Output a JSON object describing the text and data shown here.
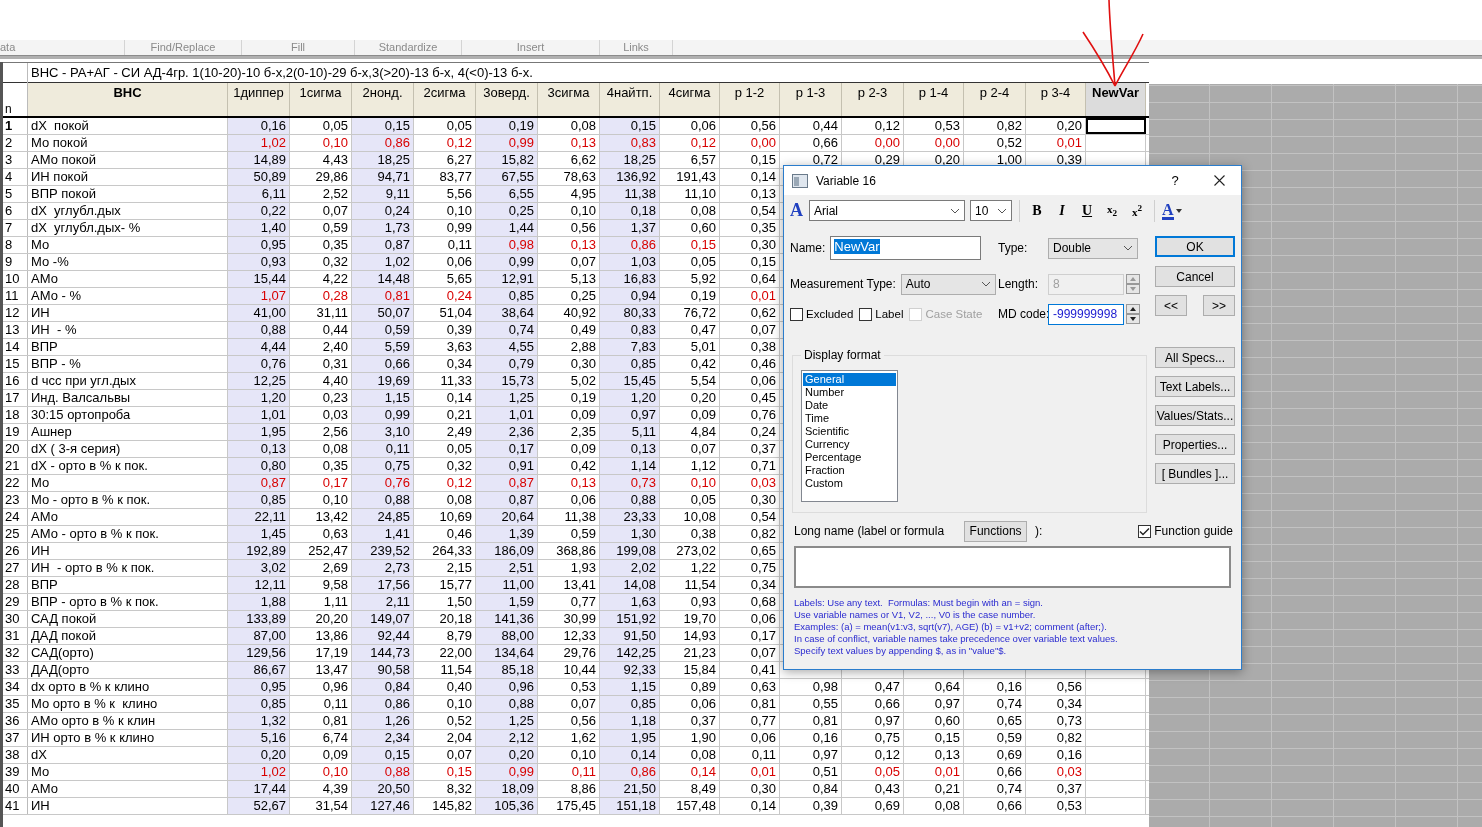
{
  "ribbon_groups": [
    "ata",
    "Find/Replace",
    "Fill",
    "Standardize",
    "Insert",
    "Links"
  ],
  "sheet": {
    "title": "ВНС - РА+АГ - СИ АД-4гр. 1(10-20)-10 б-х,2(0-10)-29 б-х,3(>20)-13 б-х, 4(<0)-13 б-х.",
    "row_header_label": "n",
    "label_column": {
      "label": "ВНС"
    },
    "columns": [
      {
        "label": "1диппер",
        "shaded": true,
        "selected": false
      },
      {
        "label": "1сигма",
        "shaded": false,
        "selected": false
      },
      {
        "label": "2нонд.",
        "shaded": true,
        "selected": false
      },
      {
        "label": "2сигма",
        "shaded": false,
        "selected": false
      },
      {
        "label": "3оверд.",
        "shaded": true,
        "selected": false
      },
      {
        "label": "3сигма",
        "shaded": false,
        "selected": false
      },
      {
        "label": "4найтп.",
        "shaded": true,
        "selected": false
      },
      {
        "label": "4сигма",
        "shaded": false,
        "selected": false
      },
      {
        "label": "p 1-2",
        "shaded": false,
        "selected": false
      },
      {
        "label": "p 1-3",
        "shaded": false,
        "selected": false
      },
      {
        "label": "p 2-3",
        "shaded": false,
        "selected": false
      },
      {
        "label": "p 1-4",
        "shaded": false,
        "selected": false
      },
      {
        "label": "p 2-4",
        "shaded": false,
        "selected": false
      },
      {
        "label": "p 3-4",
        "shaded": false,
        "selected": false
      },
      {
        "label": "NewVar",
        "shaded": false,
        "selected": true
      }
    ],
    "rows": [
      {
        "n": "1",
        "name": "dX  покой",
        "selected": true,
        "cells": [
          "0,16",
          "0,05",
          "0,15",
          "0,05",
          "0,19",
          "0,08",
          "0,15",
          "0,06",
          "0,56",
          "0,44",
          "0,12",
          "0,53",
          "0,82",
          "0,20"
        ],
        "red": [
          false,
          false,
          false,
          false,
          false,
          false,
          false,
          false,
          false,
          false,
          false,
          false,
          false,
          false
        ]
      },
      {
        "n": "2",
        "name": "Мо покой",
        "selected": false,
        "cells": [
          "1,02",
          "0,10",
          "0,86",
          "0,12",
          "0,99",
          "0,13",
          "0,83",
          "0,12",
          "0,00",
          "0,66",
          "0,00",
          "0,00",
          "0,52",
          "0,01"
        ],
        "red": [
          true,
          true,
          true,
          true,
          true,
          true,
          true,
          true,
          true,
          false,
          true,
          true,
          false,
          true
        ]
      },
      {
        "n": "3",
        "name": "АМо покой",
        "selected": false,
        "cells": [
          "14,89",
          "4,43",
          "18,25",
          "6,27",
          "15,82",
          "6,62",
          "18,25",
          "6,57",
          "0,15",
          "0,72",
          "0,29",
          "0,20",
          "1,00",
          "0,39"
        ],
        "red": [
          false,
          false,
          false,
          false,
          false,
          false,
          false,
          false,
          false,
          false,
          false,
          false,
          false,
          false
        ]
      },
      {
        "n": "4",
        "name": "ИН покой",
        "selected": false,
        "cells": [
          "50,89",
          "29,86",
          "94,71",
          "83,77",
          "67,55",
          "78,63",
          "136,92",
          "191,43",
          "0,14"
        ],
        "red": [
          false,
          false,
          false,
          false,
          false,
          false,
          false,
          false,
          false
        ]
      },
      {
        "n": "5",
        "name": "ВПР покой",
        "selected": false,
        "cells": [
          "6,11",
          "2,52",
          "9,11",
          "5,56",
          "6,55",
          "4,95",
          "11,38",
          "11,10",
          "0,13"
        ],
        "red": [
          false,
          false,
          false,
          false,
          false,
          false,
          false,
          false,
          false
        ]
      },
      {
        "n": "6",
        "name": "dX  углубл.дых",
        "selected": false,
        "cells": [
          "0,22",
          "0,07",
          "0,24",
          "0,10",
          "0,25",
          "0,10",
          "0,18",
          "0,08",
          "0,54"
        ],
        "red": [
          false,
          false,
          false,
          false,
          false,
          false,
          false,
          false,
          false
        ]
      },
      {
        "n": "7",
        "name": "dX  углубл.дых- %",
        "selected": false,
        "cells": [
          "1,40",
          "0,59",
          "1,73",
          "0,99",
          "1,44",
          "0,56",
          "1,37",
          "0,60",
          "0,35"
        ],
        "red": [
          false,
          false,
          false,
          false,
          false,
          false,
          false,
          false,
          false
        ]
      },
      {
        "n": "8",
        "name": "Мо",
        "selected": false,
        "cells": [
          "0,95",
          "0,35",
          "0,87",
          "0,11",
          "0,98",
          "0,13",
          "0,86",
          "0,15",
          "0,30"
        ],
        "red": [
          false,
          false,
          false,
          false,
          true,
          true,
          true,
          true,
          false
        ]
      },
      {
        "n": "9",
        "name": "Мо -%",
        "selected": false,
        "cells": [
          "0,93",
          "0,32",
          "1,02",
          "0,06",
          "0,99",
          "0,07",
          "1,03",
          "0,05",
          "0,15"
        ],
        "red": [
          false,
          false,
          false,
          false,
          false,
          false,
          false,
          false,
          false
        ]
      },
      {
        "n": "10",
        "name": "АМо",
        "selected": false,
        "cells": [
          "15,44",
          "4,22",
          "14,48",
          "5,65",
          "12,91",
          "5,13",
          "16,83",
          "5,92",
          "0,64"
        ],
        "red": [
          false,
          false,
          false,
          false,
          false,
          false,
          false,
          false,
          false
        ]
      },
      {
        "n": "11",
        "name": "АМо - %",
        "selected": false,
        "cells": [
          "1,07",
          "0,28",
          "0,81",
          "0,24",
          "0,85",
          "0,25",
          "0,94",
          "0,19",
          "0,01"
        ],
        "red": [
          true,
          true,
          true,
          true,
          false,
          false,
          false,
          false,
          true
        ]
      },
      {
        "n": "12",
        "name": "ИН",
        "selected": false,
        "cells": [
          "41,00",
          "31,11",
          "50,07",
          "51,04",
          "38,64",
          "40,92",
          "80,33",
          "76,72",
          "0,62"
        ],
        "red": [
          false,
          false,
          false,
          false,
          false,
          false,
          false,
          false,
          false
        ]
      },
      {
        "n": "13",
        "name": "ИН  - %",
        "selected": false,
        "cells": [
          "0,88",
          "0,44",
          "0,59",
          "0,39",
          "0,74",
          "0,49",
          "0,83",
          "0,47",
          "0,07"
        ],
        "red": [
          false,
          false,
          false,
          false,
          false,
          false,
          false,
          false,
          false
        ]
      },
      {
        "n": "14",
        "name": "ВПР",
        "selected": false,
        "cells": [
          "4,44",
          "2,40",
          "5,59",
          "3,63",
          "4,55",
          "2,88",
          "7,83",
          "5,01",
          "0,38"
        ],
        "red": [
          false,
          false,
          false,
          false,
          false,
          false,
          false,
          false,
          false
        ]
      },
      {
        "n": "15",
        "name": "ВПР - %",
        "selected": false,
        "cells": [
          "0,76",
          "0,31",
          "0,66",
          "0,34",
          "0,79",
          "0,30",
          "0,85",
          "0,42",
          "0,46"
        ],
        "red": [
          false,
          false,
          false,
          false,
          false,
          false,
          false,
          false,
          false
        ]
      },
      {
        "n": "16",
        "name": "d чсс при угл.дых",
        "selected": false,
        "cells": [
          "12,25",
          "4,40",
          "19,69",
          "11,33",
          "15,73",
          "5,02",
          "15,45",
          "5,54",
          "0,06"
        ],
        "red": [
          false,
          false,
          false,
          false,
          false,
          false,
          false,
          false,
          false
        ]
      },
      {
        "n": "17",
        "name": "Инд. Валсальвы",
        "selected": false,
        "cells": [
          "1,20",
          "0,23",
          "1,15",
          "0,14",
          "1,25",
          "0,19",
          "1,20",
          "0,20",
          "0,45"
        ],
        "red": [
          false,
          false,
          false,
          false,
          false,
          false,
          false,
          false,
          false
        ]
      },
      {
        "n": "18",
        "name": "30:15 ортопроба",
        "selected": false,
        "cells": [
          "1,01",
          "0,03",
          "0,99",
          "0,21",
          "1,01",
          "0,09",
          "0,97",
          "0,09",
          "0,76"
        ],
        "red": [
          false,
          false,
          false,
          false,
          false,
          false,
          false,
          false,
          false
        ]
      },
      {
        "n": "19",
        "name": "Ашнер",
        "selected": false,
        "cells": [
          "1,95",
          "2,56",
          "3,10",
          "2,49",
          "2,36",
          "2,35",
          "5,11",
          "4,84",
          "0,24"
        ],
        "red": [
          false,
          false,
          false,
          false,
          false,
          false,
          false,
          false,
          false
        ]
      },
      {
        "n": "20",
        "name": "dX ( 3-я серия)",
        "selected": false,
        "cells": [
          "0,13",
          "0,08",
          "0,11",
          "0,05",
          "0,17",
          "0,09",
          "0,13",
          "0,07",
          "0,37"
        ],
        "red": [
          false,
          false,
          false,
          false,
          false,
          false,
          false,
          false,
          false
        ]
      },
      {
        "n": "21",
        "name": "dX - орто в % к пок.",
        "selected": false,
        "cells": [
          "0,80",
          "0,35",
          "0,75",
          "0,32",
          "0,91",
          "0,42",
          "1,14",
          "1,12",
          "0,71"
        ],
        "red": [
          false,
          false,
          false,
          false,
          false,
          false,
          false,
          false,
          false
        ]
      },
      {
        "n": "22",
        "name": "Мо",
        "selected": false,
        "cells": [
          "0,87",
          "0,17",
          "0,76",
          "0,12",
          "0,87",
          "0,13",
          "0,73",
          "0,10",
          "0,03"
        ],
        "red": [
          true,
          true,
          true,
          true,
          true,
          true,
          true,
          true,
          true
        ]
      },
      {
        "n": "23",
        "name": "Мо - орто в % к пок.",
        "selected": false,
        "cells": [
          "0,85",
          "0,10",
          "0,88",
          "0,08",
          "0,87",
          "0,06",
          "0,88",
          "0,05",
          "0,30"
        ],
        "red": [
          false,
          false,
          false,
          false,
          false,
          false,
          false,
          false,
          false
        ]
      },
      {
        "n": "24",
        "name": "АМо",
        "selected": false,
        "cells": [
          "22,11",
          "13,42",
          "24,85",
          "10,69",
          "20,64",
          "11,38",
          "23,33",
          "10,08",
          "0,54"
        ],
        "red": [
          false,
          false,
          false,
          false,
          false,
          false,
          false,
          false,
          false
        ]
      },
      {
        "n": "25",
        "name": "АМо - орто в % к пок.",
        "selected": false,
        "cells": [
          "1,45",
          "0,63",
          "1,41",
          "0,46",
          "1,39",
          "0,59",
          "1,30",
          "0,38",
          "0,82"
        ],
        "red": [
          false,
          false,
          false,
          false,
          false,
          false,
          false,
          false,
          false
        ]
      },
      {
        "n": "26",
        "name": "ИН",
        "selected": false,
        "cells": [
          "192,89",
          "252,47",
          "239,52",
          "264,33",
          "186,09",
          "368,86",
          "199,08",
          "273,02",
          "0,65"
        ],
        "red": [
          false,
          false,
          false,
          false,
          false,
          false,
          false,
          false,
          false
        ]
      },
      {
        "n": "27",
        "name": "ИН  - орто в % к пок.",
        "selected": false,
        "cells": [
          "3,02",
          "2,69",
          "2,73",
          "2,15",
          "2,51",
          "1,93",
          "2,02",
          "1,22",
          "0,75"
        ],
        "red": [
          false,
          false,
          false,
          false,
          false,
          false,
          false,
          false,
          false
        ]
      },
      {
        "n": "28",
        "name": "ВПР",
        "selected": false,
        "cells": [
          "12,11",
          "9,58",
          "17,56",
          "15,77",
          "11,00",
          "13,41",
          "14,08",
          "11,54",
          "0,34"
        ],
        "red": [
          false,
          false,
          false,
          false,
          false,
          false,
          false,
          false,
          false
        ]
      },
      {
        "n": "29",
        "name": "ВПР - орто в % к пок.",
        "selected": false,
        "cells": [
          "1,88",
          "1,11",
          "2,11",
          "1,50",
          "1,59",
          "0,77",
          "1,63",
          "0,93",
          "0,68"
        ],
        "red": [
          false,
          false,
          false,
          false,
          false,
          false,
          false,
          false,
          false
        ]
      },
      {
        "n": "30",
        "name": "САД покой",
        "selected": false,
        "cells": [
          "133,89",
          "20,20",
          "149,07",
          "20,18",
          "141,36",
          "30,99",
          "151,92",
          "19,70",
          "0,06"
        ],
        "red": [
          false,
          false,
          false,
          false,
          false,
          false,
          false,
          false,
          false
        ]
      },
      {
        "n": "31",
        "name": "ДАД покой",
        "selected": false,
        "cells": [
          "87,00",
          "13,86",
          "92,44",
          "8,79",
          "88,00",
          "12,33",
          "91,50",
          "14,93",
          "0,17"
        ],
        "red": [
          false,
          false,
          false,
          false,
          false,
          false,
          false,
          false,
          false
        ]
      },
      {
        "n": "32",
        "name": "САД(орто)",
        "selected": false,
        "cells": [
          "129,56",
          "17,19",
          "144,73",
          "22,00",
          "134,64",
          "29,76",
          "142,25",
          "21,23",
          "0,07"
        ],
        "red": [
          false,
          false,
          false,
          false,
          false,
          false,
          false,
          false,
          false
        ]
      },
      {
        "n": "33",
        "name": "ДАД(орто",
        "selected": false,
        "cells": [
          "86,67",
          "13,47",
          "90,58",
          "11,54",
          "85,18",
          "10,44",
          "92,33",
          "15,84",
          "0,41"
        ],
        "red": [
          false,
          false,
          false,
          false,
          false,
          false,
          false,
          false,
          false
        ]
      },
      {
        "n": "34",
        "name": "dx орто в % к клино",
        "selected": false,
        "cells": [
          "0,95",
          "0,96",
          "0,84",
          "0,40",
          "0,96",
          "0,53",
          "1,15",
          "0,89",
          "0,63",
          "0,98",
          "0,47",
          "0,64",
          "0,16",
          "0,56"
        ],
        "red": [
          false,
          false,
          false,
          false,
          false,
          false,
          false,
          false,
          false,
          false,
          false,
          false,
          false,
          false
        ]
      },
      {
        "n": "35",
        "name": "Мо орто в % к  клино",
        "selected": false,
        "cells": [
          "0,85",
          "0,11",
          "0,86",
          "0,10",
          "0,88",
          "0,07",
          "0,85",
          "0,06",
          "0,81",
          "0,55",
          "0,66",
          "0,97",
          "0,74",
          "0,34"
        ],
        "red": [
          false,
          false,
          false,
          false,
          false,
          false,
          false,
          false,
          false,
          false,
          false,
          false,
          false,
          false
        ]
      },
      {
        "n": "36",
        "name": "АМо орто в % к клин",
        "selected": false,
        "cells": [
          "1,32",
          "0,81",
          "1,26",
          "0,52",
          "1,25",
          "0,56",
          "1,18",
          "0,37",
          "0,77",
          "0,81",
          "0,97",
          "0,60",
          "0,65",
          "0,73"
        ],
        "red": [
          false,
          false,
          false,
          false,
          false,
          false,
          false,
          false,
          false,
          false,
          false,
          false,
          false,
          false
        ]
      },
      {
        "n": "37",
        "name": "ИН орто в % к клино",
        "selected": false,
        "cells": [
          "5,16",
          "6,74",
          "2,34",
          "2,04",
          "2,12",
          "1,62",
          "1,95",
          "1,90",
          "0,06",
          "0,16",
          "0,75",
          "0,15",
          "0,59",
          "0,82"
        ],
        "red": [
          false,
          false,
          false,
          false,
          false,
          false,
          false,
          false,
          false,
          false,
          false,
          false,
          false,
          false
        ]
      },
      {
        "n": "38",
        "name": "dX",
        "selected": false,
        "cells": [
          "0,20",
          "0,09",
          "0,15",
          "0,07",
          "0,20",
          "0,10",
          "0,14",
          "0,08",
          "0,11",
          "0,97",
          "0,12",
          "0,13",
          "0,69",
          "0,16"
        ],
        "red": [
          false,
          false,
          false,
          false,
          false,
          false,
          false,
          false,
          false,
          false,
          false,
          false,
          false,
          false
        ]
      },
      {
        "n": "39",
        "name": "Мо",
        "selected": false,
        "cells": [
          "1,02",
          "0,10",
          "0,88",
          "0,15",
          "0,99",
          "0,11",
          "0,86",
          "0,14",
          "0,01",
          "0,51",
          "0,05",
          "0,01",
          "0,66",
          "0,03"
        ],
        "red": [
          true,
          true,
          true,
          true,
          true,
          true,
          true,
          true,
          true,
          false,
          true,
          true,
          false,
          true
        ]
      },
      {
        "n": "40",
        "name": "АМо",
        "selected": false,
        "cells": [
          "17,44",
          "4,39",
          "20,50",
          "8,32",
          "18,09",
          "8,86",
          "21,50",
          "8,49",
          "0,30",
          "0,84",
          "0,43",
          "0,21",
          "0,74",
          "0,37"
        ],
        "red": [
          false,
          false,
          false,
          false,
          false,
          false,
          false,
          false,
          false,
          false,
          false,
          false,
          false,
          false
        ]
      },
      {
        "n": "41",
        "name": "ИН",
        "selected": false,
        "cells": [
          "52,67",
          "31,54",
          "127,46",
          "145,82",
          "105,36",
          "175,45",
          "151,18",
          "157,48",
          "0,14",
          "0,39",
          "0,69",
          "0,08",
          "0,66",
          "0,53"
        ],
        "red": [
          false,
          false,
          false,
          false,
          false,
          false,
          false,
          false,
          false,
          false,
          false,
          false,
          false,
          false
        ]
      }
    ]
  },
  "dialog": {
    "title": "Variable 16",
    "help_button": "?",
    "font_icon": "A",
    "font": "Arial",
    "font_size": "10",
    "format_buttons": [
      {
        "kind": "bold",
        "label": "B"
      },
      {
        "kind": "italic",
        "label": "I"
      },
      {
        "kind": "underline",
        "label": "U"
      },
      {
        "kind": "subscript",
        "label": "x$_{2}$"
      },
      {
        "kind": "superscript",
        "label": "x$^{2}$"
      }
    ],
    "font_color": "A",
    "name_label": "Name:",
    "name_value": "NewVar",
    "type_label": "Type:",
    "type_value": "Double",
    "measurement_label": "Measurement Type:",
    "measurement_value": "Auto",
    "length_label": "Length:",
    "length_value": "8",
    "length_disabled": true,
    "checkboxes": [
      {
        "label": "Excluded",
        "checked": false,
        "disabled": false
      },
      {
        "label": "Label",
        "checked": false,
        "disabled": false
      },
      {
        "label": "Case State",
        "checked": false,
        "disabled": true
      }
    ],
    "md_label": "MD code:",
    "md_value": "-999999998",
    "ok": "OK",
    "cancel": "Cancel",
    "prev": "<<",
    "next": ">>",
    "display_format_label": "Display format",
    "formats": [
      {
        "label": "General",
        "selected": true
      },
      {
        "label": "Number",
        "selected": false
      },
      {
        "label": "Date",
        "selected": false
      },
      {
        "label": "Time",
        "selected": false
      },
      {
        "label": "Scientific",
        "selected": false
      },
      {
        "label": "Currency",
        "selected": false
      },
      {
        "label": "Percentage",
        "selected": false
      },
      {
        "label": "Fraction",
        "selected": false
      },
      {
        "label": "Custom",
        "selected": false
      }
    ],
    "side_buttons": [
      "All Specs...",
      "Text Labels...",
      "Values/Stats...",
      "Properties...",
      "[ Bundles ]..."
    ],
    "long_name_label": "Long name (label or formula",
    "functions_button": "Functions",
    "long_name_suffix": "):",
    "function_guide": {
      "label": "Function guide",
      "checked": true
    },
    "help_lines": [
      "Labels: Use any text.  Formulas: Must begin with an = sign.",
      "Use variable names or V1, V2, ..., V0 is the case number.",
      "Examples: (a) = mean(v1:v3, sqrt(v7), AGE) (b) = v1+v2; comment (after;).",
      "In case of conflict, variable names take precedence over variable text values.",
      "Specify text values by appending $, as in \"value\"$."
    ]
  }
}
